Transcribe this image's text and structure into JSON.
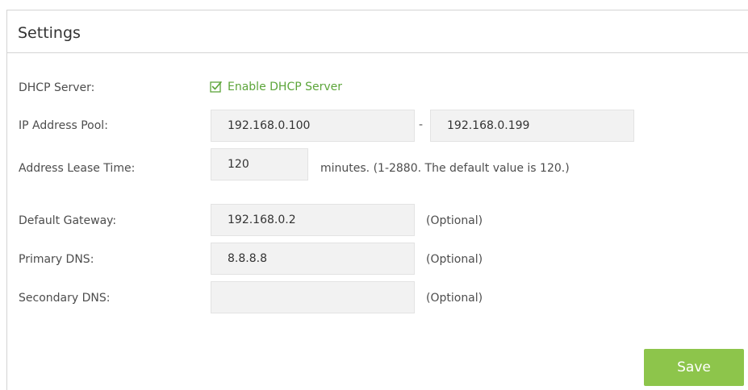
{
  "settings": {
    "title": "Settings",
    "dhcp_server": {
      "label": "DHCP Server:",
      "checkbox_label": "Enable DHCP Server",
      "checked": true
    },
    "ip_pool": {
      "label": "IP Address Pool:",
      "start": "192.168.0.100",
      "separator": "-",
      "end": "192.168.0.199"
    },
    "lease_time": {
      "label": "Address Lease Time:",
      "value": "120",
      "hint": "minutes. (1-2880. The default value is 120.)"
    },
    "default_gateway": {
      "label": "Default Gateway:",
      "value": "192.168.0.2",
      "hint": "(Optional)"
    },
    "primary_dns": {
      "label": "Primary DNS:",
      "value": "8.8.8.8",
      "hint": "(Optional)"
    },
    "secondary_dns": {
      "label": "Secondary DNS:",
      "value": "",
      "hint": "(Optional)"
    },
    "save_label": "Save"
  },
  "colors": {
    "accent_green": "#5ca53a",
    "button_green": "#8dc54b",
    "field_bg": "#f2f2f2"
  },
  "icons": {
    "checkbox": "checkbox-checked-icon"
  }
}
